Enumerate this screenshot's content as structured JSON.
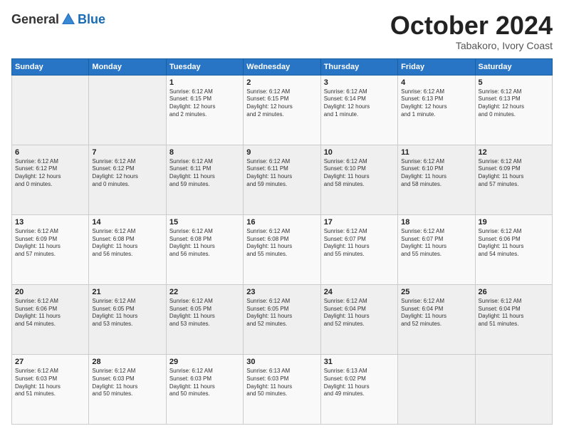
{
  "header": {
    "logo_general": "General",
    "logo_blue": "Blue",
    "month": "October 2024",
    "location": "Tabakoro, Ivory Coast"
  },
  "days_of_week": [
    "Sunday",
    "Monday",
    "Tuesday",
    "Wednesday",
    "Thursday",
    "Friday",
    "Saturday"
  ],
  "weeks": [
    [
      {
        "day": "",
        "content": ""
      },
      {
        "day": "",
        "content": ""
      },
      {
        "day": "1",
        "content": "Sunrise: 6:12 AM\nSunset: 6:15 PM\nDaylight: 12 hours\nand 2 minutes."
      },
      {
        "day": "2",
        "content": "Sunrise: 6:12 AM\nSunset: 6:15 PM\nDaylight: 12 hours\nand 2 minutes."
      },
      {
        "day": "3",
        "content": "Sunrise: 6:12 AM\nSunset: 6:14 PM\nDaylight: 12 hours\nand 1 minute."
      },
      {
        "day": "4",
        "content": "Sunrise: 6:12 AM\nSunset: 6:13 PM\nDaylight: 12 hours\nand 1 minute."
      },
      {
        "day": "5",
        "content": "Sunrise: 6:12 AM\nSunset: 6:13 PM\nDaylight: 12 hours\nand 0 minutes."
      }
    ],
    [
      {
        "day": "6",
        "content": "Sunrise: 6:12 AM\nSunset: 6:12 PM\nDaylight: 12 hours\nand 0 minutes."
      },
      {
        "day": "7",
        "content": "Sunrise: 6:12 AM\nSunset: 6:12 PM\nDaylight: 12 hours\nand 0 minutes."
      },
      {
        "day": "8",
        "content": "Sunrise: 6:12 AM\nSunset: 6:11 PM\nDaylight: 11 hours\nand 59 minutes."
      },
      {
        "day": "9",
        "content": "Sunrise: 6:12 AM\nSunset: 6:11 PM\nDaylight: 11 hours\nand 59 minutes."
      },
      {
        "day": "10",
        "content": "Sunrise: 6:12 AM\nSunset: 6:10 PM\nDaylight: 11 hours\nand 58 minutes."
      },
      {
        "day": "11",
        "content": "Sunrise: 6:12 AM\nSunset: 6:10 PM\nDaylight: 11 hours\nand 58 minutes."
      },
      {
        "day": "12",
        "content": "Sunrise: 6:12 AM\nSunset: 6:09 PM\nDaylight: 11 hours\nand 57 minutes."
      }
    ],
    [
      {
        "day": "13",
        "content": "Sunrise: 6:12 AM\nSunset: 6:09 PM\nDaylight: 11 hours\nand 57 minutes."
      },
      {
        "day": "14",
        "content": "Sunrise: 6:12 AM\nSunset: 6:08 PM\nDaylight: 11 hours\nand 56 minutes."
      },
      {
        "day": "15",
        "content": "Sunrise: 6:12 AM\nSunset: 6:08 PM\nDaylight: 11 hours\nand 56 minutes."
      },
      {
        "day": "16",
        "content": "Sunrise: 6:12 AM\nSunset: 6:08 PM\nDaylight: 11 hours\nand 55 minutes."
      },
      {
        "day": "17",
        "content": "Sunrise: 6:12 AM\nSunset: 6:07 PM\nDaylight: 11 hours\nand 55 minutes."
      },
      {
        "day": "18",
        "content": "Sunrise: 6:12 AM\nSunset: 6:07 PM\nDaylight: 11 hours\nand 55 minutes."
      },
      {
        "day": "19",
        "content": "Sunrise: 6:12 AM\nSunset: 6:06 PM\nDaylight: 11 hours\nand 54 minutes."
      }
    ],
    [
      {
        "day": "20",
        "content": "Sunrise: 6:12 AM\nSunset: 6:06 PM\nDaylight: 11 hours\nand 54 minutes."
      },
      {
        "day": "21",
        "content": "Sunrise: 6:12 AM\nSunset: 6:05 PM\nDaylight: 11 hours\nand 53 minutes."
      },
      {
        "day": "22",
        "content": "Sunrise: 6:12 AM\nSunset: 6:05 PM\nDaylight: 11 hours\nand 53 minutes."
      },
      {
        "day": "23",
        "content": "Sunrise: 6:12 AM\nSunset: 6:05 PM\nDaylight: 11 hours\nand 52 minutes."
      },
      {
        "day": "24",
        "content": "Sunrise: 6:12 AM\nSunset: 6:04 PM\nDaylight: 11 hours\nand 52 minutes."
      },
      {
        "day": "25",
        "content": "Sunrise: 6:12 AM\nSunset: 6:04 PM\nDaylight: 11 hours\nand 52 minutes."
      },
      {
        "day": "26",
        "content": "Sunrise: 6:12 AM\nSunset: 6:04 PM\nDaylight: 11 hours\nand 51 minutes."
      }
    ],
    [
      {
        "day": "27",
        "content": "Sunrise: 6:12 AM\nSunset: 6:03 PM\nDaylight: 11 hours\nand 51 minutes."
      },
      {
        "day": "28",
        "content": "Sunrise: 6:12 AM\nSunset: 6:03 PM\nDaylight: 11 hours\nand 50 minutes."
      },
      {
        "day": "29",
        "content": "Sunrise: 6:12 AM\nSunset: 6:03 PM\nDaylight: 11 hours\nand 50 minutes."
      },
      {
        "day": "30",
        "content": "Sunrise: 6:13 AM\nSunset: 6:03 PM\nDaylight: 11 hours\nand 50 minutes."
      },
      {
        "day": "31",
        "content": "Sunrise: 6:13 AM\nSunset: 6:02 PM\nDaylight: 11 hours\nand 49 minutes."
      },
      {
        "day": "",
        "content": ""
      },
      {
        "day": "",
        "content": ""
      }
    ]
  ]
}
